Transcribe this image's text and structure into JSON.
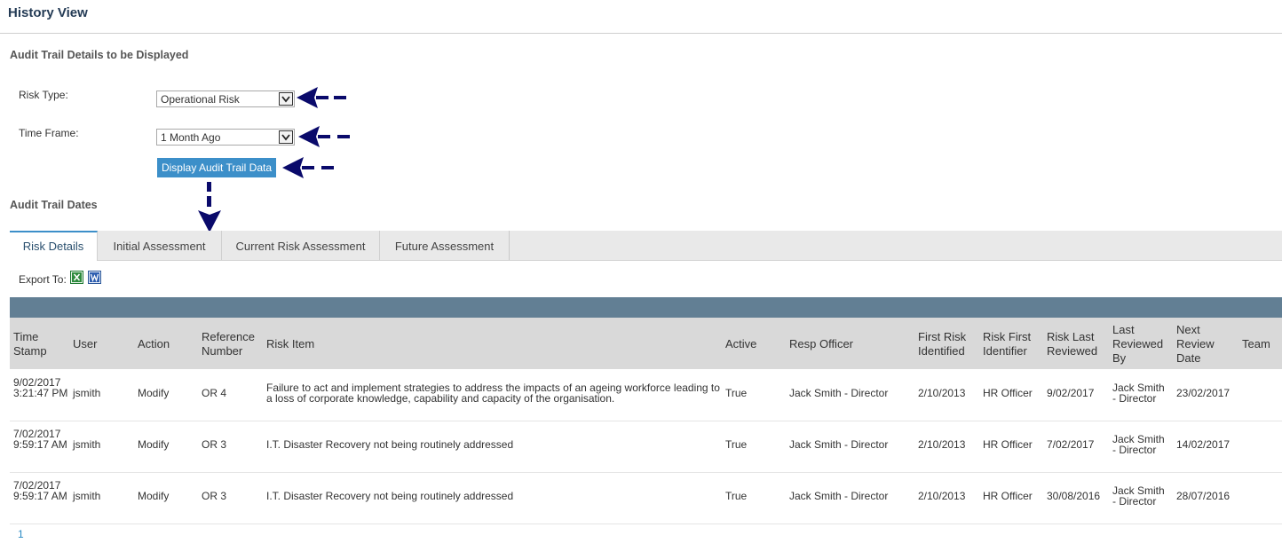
{
  "page": {
    "title": "History View"
  },
  "filters": {
    "section_title": "Audit Trail Details to be Displayed",
    "risk_type_label": "Risk Type:",
    "risk_type_value": "Operational Risk",
    "time_frame_label": "Time Frame:",
    "time_frame_value": "1 Month Ago",
    "display_button": "Display Audit Trail Data"
  },
  "dates_section_title": "Audit Trail Dates",
  "tabs": [
    {
      "label": "Risk Details",
      "active": true
    },
    {
      "label": "Initial Assessment",
      "active": false
    },
    {
      "label": "Current Risk Assessment",
      "active": false
    },
    {
      "label": "Future Assessment",
      "active": false
    }
  ],
  "export": {
    "label": "Export To:",
    "icons": [
      "excel-icon",
      "word-icon"
    ]
  },
  "table": {
    "headers": [
      "Time Stamp",
      "User",
      "Action",
      "Reference Number",
      "Risk Item",
      "Active",
      "Resp Officer",
      "First Risk Identified",
      "Risk First Identifier",
      "Risk Last Reviewed",
      "Last Reviewed By",
      "Next Review Date",
      "Team"
    ],
    "rows": [
      [
        "9/02/2017 3:21:47 PM",
        "jsmith",
        "Modify",
        "OR 4",
        "Failure to act and implement strategies to address the impacts of an ageing workforce leading to a loss of corporate knowledge, capability and capacity of the organisation.",
        "True",
        "Jack Smith - Director",
        "2/10/2013",
        "HR Officer",
        "9/02/2017",
        "Jack Smith - Director",
        "23/02/2017",
        ""
      ],
      [
        "7/02/2017 9:59:17 AM",
        "jsmith",
        "Modify",
        "OR 3",
        "I.T. Disaster Recovery not being routinely addressed",
        "True",
        "Jack Smith - Director",
        "2/10/2013",
        "HR Officer",
        "7/02/2017",
        "Jack Smith - Director",
        "14/02/2017",
        ""
      ],
      [
        "7/02/2017 9:59:17 AM",
        "jsmith",
        "Modify",
        "OR 3",
        "I.T. Disaster Recovery not being routinely addressed",
        "True",
        "Jack Smith - Director",
        "2/10/2013",
        "HR Officer",
        "30/08/2016",
        "Jack Smith - Director",
        "28/07/2016",
        ""
      ]
    ]
  },
  "pager": {
    "current_page": "1"
  },
  "colors": {
    "accent": "#3c8fc9",
    "grid_band": "#627f94",
    "header_bg": "#d9d9d9",
    "callout_arrow": "#0a0a6b"
  }
}
